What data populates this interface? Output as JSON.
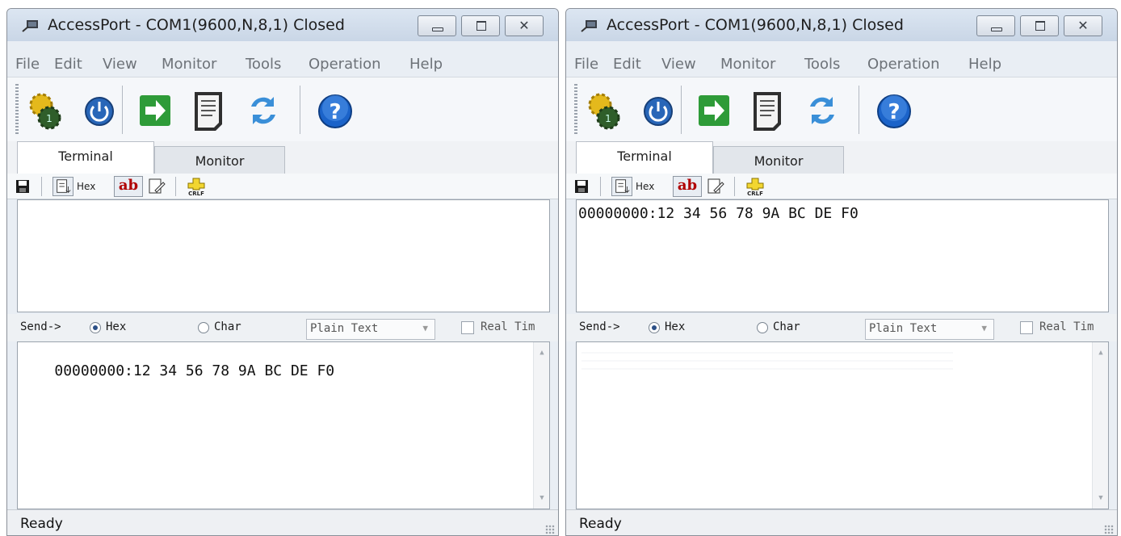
{
  "windows": [
    {
      "title": "AccessPort - COM1(9600,N,8,1) Closed",
      "menu": [
        "File",
        "Edit",
        "View",
        "Monitor",
        "Tools",
        "Operation",
        "Help"
      ],
      "tabs": [
        "Terminal",
        "Monitor"
      ],
      "hex_label": "Hex",
      "ab_label": "ab",
      "receive_text": "",
      "send_label": "Send->",
      "radio_hex": "Hex",
      "radio_char": "Char",
      "format_select": "Plain Text",
      "realtime_label": "Real Tim",
      "send_text": "00000000:12 34 56 78 9A BC DE F0",
      "status": "Ready"
    },
    {
      "title": "AccessPort - COM1(9600,N,8,1) Closed",
      "menu": [
        "File",
        "Edit",
        "View",
        "Monitor",
        "Tools",
        "Operation",
        "Help"
      ],
      "tabs": [
        "Terminal",
        "Monitor"
      ],
      "hex_label": "Hex",
      "ab_label": "ab",
      "receive_text": "00000000:12 34 56 78 9A BC DE F0",
      "send_label": "Send->",
      "radio_hex": "Hex",
      "radio_char": "Char",
      "format_select": "Plain Text",
      "realtime_label": "Real Tim",
      "send_text": "",
      "status": "Ready"
    }
  ],
  "icons": {
    "toolbar": [
      "gear-config-icon",
      "power-icon",
      "arrow-right-icon",
      "document-icon",
      "refresh-icon",
      "help-icon"
    ],
    "subtoolbar": [
      "save-icon",
      "view-mode-icon",
      "edit-icon",
      "crlf-icon"
    ]
  },
  "colors": {
    "accent": "#2b4f86",
    "ab_text": "#b00000",
    "help": "#1b63c9",
    "go": "#2e9b38"
  }
}
